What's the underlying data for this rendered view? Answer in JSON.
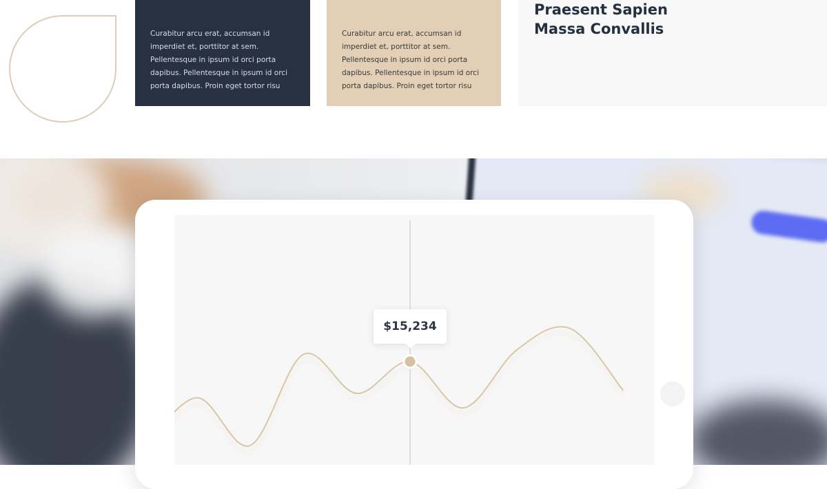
{
  "cards": {
    "dark_text": "Curabitur arcu erat, accumsan id imperdiet et, porttitor at sem. Pellentesque in ipsum id orci porta dapibus. Pellentesque in ipsum id orci porta dapibus. Proin eget tortor risu",
    "beige_text": "Curabitur arcu erat, accumsan id imperdiet et, porttitor at sem. Pellentesque in ipsum id orci porta dapibus. Pellentesque in ipsum id orci porta dapibus. Proin eget tortor risu"
  },
  "headline": {
    "line1": "Praesent Sapien",
    "line2": "Massa Convallis"
  },
  "colors": {
    "dark_card": "#273142",
    "beige_card": "#e2cfb5",
    "line": "#d9c6a8",
    "marker": "#d3c1a4"
  },
  "tooltip": {
    "value": "$15,234"
  },
  "chart_data": {
    "type": "line",
    "series": [
      {
        "values": [
          0.1,
          0.45,
          0.12,
          0.75,
          0.48,
          0.7,
          0.38,
          0.78,
          0.93,
          0.5
        ]
      }
    ],
    "highlighted_index": 5,
    "highlighted_value": "$15,234",
    "grid": false
  }
}
